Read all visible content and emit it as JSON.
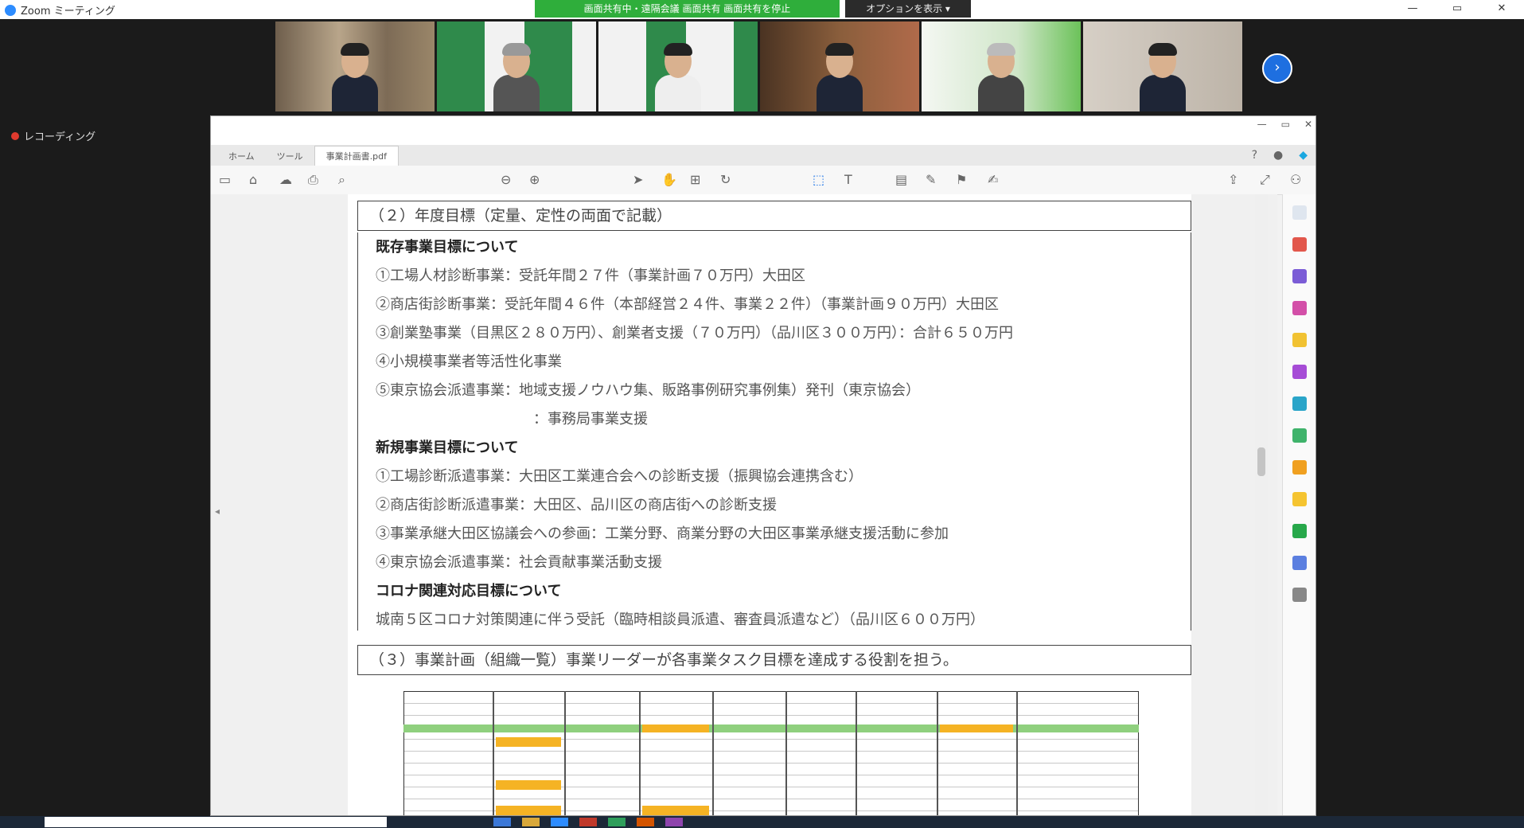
{
  "zoom": {
    "app_title": "Zoom ミーティング",
    "share_banner": "画面共有中・遠隔会議 画面共有 画面共有を停止",
    "view_options": "オプションを表示 ▾",
    "window_controls": [
      "—",
      "▭",
      "✕"
    ],
    "recording_label": "レコーディング",
    "next_button": "›"
  },
  "participants": [
    {
      "name": "",
      "bg": "#8a7a66"
    },
    {
      "name": "",
      "bg": "#2f8a4b"
    },
    {
      "name": "",
      "bg": "#2f8a4b"
    },
    {
      "name": "",
      "bg": "#6b4a2e"
    },
    {
      "name": "",
      "bg": "#d8e8d4"
    },
    {
      "name": "",
      "bg": "#c9c2b8"
    }
  ],
  "pdf": {
    "window_title": "",
    "menu": [],
    "tabs": [
      "ホーム",
      "ツール",
      "事業計画書.pdf"
    ],
    "sections": {
      "sec2_header": "（２）年度目標（定量、定性の両面で記載）",
      "sec3_header": "（３）事業計画（組織一覧）事業リーダーが各事業タスク目標を達成する役割を担う。"
    },
    "lines": [
      {
        "text": "既存事業目標について",
        "bold": true
      },
      {
        "text": "①工場人材診断事業：受託年間２７件（事業計画７０万円）大田区",
        "bold": false
      },
      {
        "text": "②商店街診断事業：受託年間４６件（本部経営２４件、事業２２件）（事業計画９０万円）大田区",
        "bold": false
      },
      {
        "text": "③創業塾事業（目黒区２８０万円）、創業者支援（７０万円）（品川区３００万円）：合計６５０万円",
        "bold": false
      },
      {
        "text": "④小規模事業者等活性化事業",
        "bold": false
      },
      {
        "text": "⑤東京協会派遣事業：地域支援ノウハウ集、販路事例研究事例集）発刊（東京協会）",
        "bold": false
      },
      {
        "text": "　　　　　　　　　　　：事務局事業支援",
        "bold": false
      },
      {
        "text": "新規事業目標について",
        "bold": true
      },
      {
        "text": "①工場診断派遣事業：大田区工業連合会への診断支援（振興協会連携含む）",
        "bold": false
      },
      {
        "text": "②商店街診断派遣事業：大田区、品川区の商店街への診断支援",
        "bold": false
      },
      {
        "text": "③事業承継大田区協議会への参画：工業分野、商業分野の大田区事業承継支援活動に参加",
        "bold": false
      },
      {
        "text": "④東京協会派遣事業：社会貢献事業活動支援",
        "bold": false
      },
      {
        "text": "コロナ関連対応目標について",
        "bold": true
      },
      {
        "text": "城南５区コロナ対策関連に伴う受託（臨時相談員派遣、審査員派遣など）（品川区６００万円）",
        "bold": false
      }
    ]
  },
  "icons": {
    "zoom_logo": "video-camera-icon",
    "toolbar": [
      "page-icon",
      "home-icon",
      "cloud-icon",
      "print-icon",
      "search-icon",
      "zoom-out-icon",
      "zoom-in-icon",
      "cursor-icon",
      "hand-icon",
      "fit-icon",
      "rotate-icon",
      "select-icon",
      "typewriter-icon",
      "comment-icon",
      "pen-icon",
      "stamp-icon",
      "share-icon",
      "expand-icon",
      "sign-icon"
    ],
    "side_panel": [
      "search-icon",
      "export-pdf-icon",
      "edit-pdf-icon",
      "organize-icon",
      "comment-icon",
      "fill-sign-icon",
      "protect-icon",
      "compress-icon",
      "more-tools-icon"
    ]
  },
  "colors": {
    "banner_green": "#2fae3b",
    "recording_red": "#e03a2e",
    "sheet_green": "#8fd07e",
    "sheet_orange": "#f5b324"
  }
}
